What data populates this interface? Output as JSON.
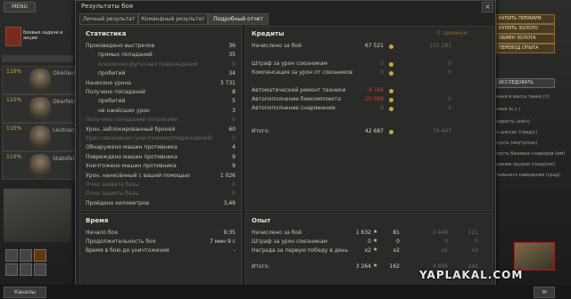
{
  "client": {
    "menu_label": "MENU",
    "left": {
      "crew": [
        {
          "pct": "110%",
          "name": "Oberleutn"
        },
        {
          "pct": "110%",
          "name": "Oberfeldw"
        },
        {
          "pct": "110%",
          "name": "Leutnant"
        },
        {
          "pct": "110%",
          "name": "Stabsfeldw"
        }
      ],
      "hangar_label": "Боевые задачи и акции",
      "channels_button": "Каналы"
    },
    "right": {
      "buttons": [
        "КУПИТЬ ПРЕМИУМ",
        "КУПИТЬ ЗОЛОТО",
        "ОБМЕН ЗОЛОТА",
        "ПЕРЕВОД ОПЫТА"
      ],
      "research": "ИССЛЕДОВАТЬ",
      "lines": [
        "наня в масса танка (т)",
        "наня (к.с.)",
        "аярость (км/ч)",
        "а шассис (град/с)",
        "пусть (мм/тр/сек)",
        "пусть базовых снарядов (мм)",
        "щение орудия (град/сек)",
        "тального наведения (град)"
      ]
    }
  },
  "dialog": {
    "title": "Результаты боя",
    "tabs": [
      "Личный результат",
      "Командный результат",
      "Подробный отчет"
    ],
    "statistics": {
      "header": "Статистика",
      "rows": [
        {
          "label": "Произведено выстрелов",
          "value": "36",
          "indent": 0
        },
        {
          "label": "прямых попаданий",
          "value": "35",
          "indent": 1
        },
        {
          "label": "осколочно-фугасных повреждений",
          "value": "0",
          "indent": 1,
          "dim": true
        },
        {
          "label": "пробитий",
          "value": "34",
          "indent": 1
        },
        {
          "label": "Нанесено урона",
          "value": "3 731",
          "indent": 0
        },
        {
          "label": "Получено попаданий",
          "value": "8",
          "indent": 0
        },
        {
          "label": "пробитий",
          "value": "5",
          "indent": 1
        },
        {
          "label": "не нанёсших урон",
          "value": "3",
          "indent": 1
        },
        {
          "label": "Получено попаданий осколками",
          "value": "0",
          "indent": 0,
          "dim": true
        },
        {
          "label": "Урон, заблокированный броней",
          "value": "60",
          "indent": 0
        },
        {
          "label": "Урон союзникам (уничтожено/повреждений)",
          "value": "0",
          "indent": 0,
          "dim": true
        },
        {
          "label": "Обнаружено машин противника",
          "value": "4",
          "indent": 0
        },
        {
          "label": "Повреждено машин противника",
          "value": "9",
          "indent": 0
        },
        {
          "label": "Уничтожено машин противника",
          "value": "9",
          "indent": 0
        },
        {
          "label": "Урон, нанесённый с вашей помощью",
          "value": "1 026",
          "indent": 0
        },
        {
          "label": "Очки захвата базы",
          "value": "0",
          "indent": 0,
          "dim": true
        },
        {
          "label": "Очки защиты базы",
          "value": "0",
          "indent": 0,
          "dim": true
        },
        {
          "label": "Пройдено километров",
          "value": "3,49",
          "indent": 0
        }
      ]
    },
    "credits": {
      "header": "Кредиты",
      "premium_label": "С премиум",
      "rows": [
        {
          "label": "Начислено за бой",
          "value": "67 521",
          "prem": "101 281",
          "gap": false
        },
        {
          "label": "Штраф за урон союзникам",
          "value": "0",
          "prem": "0",
          "gap": true,
          "dim": true
        },
        {
          "label": "Компенсация за урон от союзников",
          "value": "0",
          "prem": "0",
          "gap": false,
          "dim": true
        },
        {
          "label": "Автоматический ремонт техники",
          "value": "-4 766",
          "prem": "",
          "gap": true,
          "red": true
        },
        {
          "label": "Автопополнение боекомплекта",
          "value": "-20 068",
          "prem": "0",
          "gap": false,
          "red": true
        },
        {
          "label": "Автопополнение снаряжения",
          "value": "0",
          "prem": "0",
          "gap": false,
          "dim": true
        }
      ],
      "total_label": "Итого:",
      "total_value": "42 687",
      "total_prem": "76 447"
    },
    "time": {
      "header": "Время",
      "rows": [
        {
          "label": "Начало боя",
          "value": "9:35"
        },
        {
          "label": "Продолжительность боя",
          "value": "7 мин 9 с"
        },
        {
          "label": "Время в бою до уничтожения",
          "value": "-"
        }
      ]
    },
    "experience": {
      "header": "Опыт",
      "rows": [
        {
          "label": "Начислено за бой",
          "value": "1 632",
          "free": "81",
          "prem": "2 448",
          "prem_free": "121"
        },
        {
          "label": "Штраф за урон союзникам",
          "value": "0",
          "free": "0",
          "prem": "0",
          "prem_free": "0"
        },
        {
          "label": "Награда за первую победу в день",
          "value": "x2",
          "free": "x2",
          "prem": "x2",
          "prem_free": "x2"
        }
      ],
      "total_label": "Итого:",
      "total_value": "3 264",
      "total_free": "162",
      "total_prem": "4 896",
      "total_prem_free": "242"
    }
  },
  "watermark": "YAPLAKAL.COM"
}
